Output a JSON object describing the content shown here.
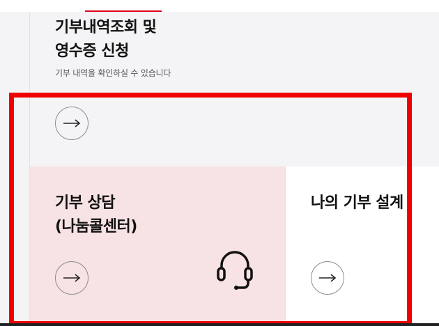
{
  "cards": {
    "donation_history": {
      "title_line1": "기부내역조회 및",
      "title_line2": "영수증 신청",
      "description": "기부 내역을 확인하실 수 있습니다"
    },
    "consultation": {
      "title_line1": "기부 상담",
      "title_line2": "(나눔콜센터)",
      "icon": "headset-icon"
    },
    "my_design": {
      "title": "나의 기부 설계"
    }
  },
  "colors": {
    "accent_red": "#e3001b",
    "highlight_red": "#ee0000",
    "consult_bg": "#f7e2e4",
    "page_bg": "#f4f4f6"
  }
}
